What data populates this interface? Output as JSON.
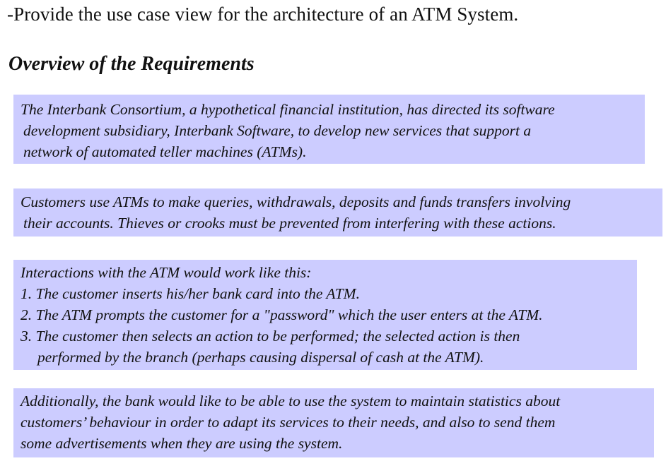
{
  "title": "-Provide the use case view for the architecture of an ATM System.",
  "heading": "Overview of the Requirements",
  "boxes": [
    {
      "lines": [
        "The Interbank Consortium, a hypothetical financial institution, has directed its software",
        "development subsidiary, Interbank Software, to develop new services that support a",
        "network of automated teller machines (ATMs)."
      ]
    },
    {
      "lines": [
        "Customers use ATMs to make queries, withdrawals, deposits and funds transfers involving",
        "their accounts. Thieves or crooks must be prevented from interfering with these actions."
      ]
    },
    {
      "lines": [
        "Interactions with the ATM would work like this:",
        "1. The customer inserts his/her bank card into the ATM.",
        "2. The ATM prompts the customer for a \"password\" which the user enters at the ATM.",
        "3. The customer then selects an action to be performed; the selected action is then",
        "performed by the branch (perhaps causing dispersal of cash at the ATM)."
      ]
    },
    {
      "lines": [
        "Additionally, the bank would like to be able to use the system to maintain statistics about",
        "customers’ behaviour in order to adapt its services to their needs, and also to send them",
        "some advertisements when they are using the system."
      ]
    }
  ],
  "colors": {
    "box_background": "#ccccff",
    "text": "#111111",
    "page_background": "#ffffff"
  }
}
